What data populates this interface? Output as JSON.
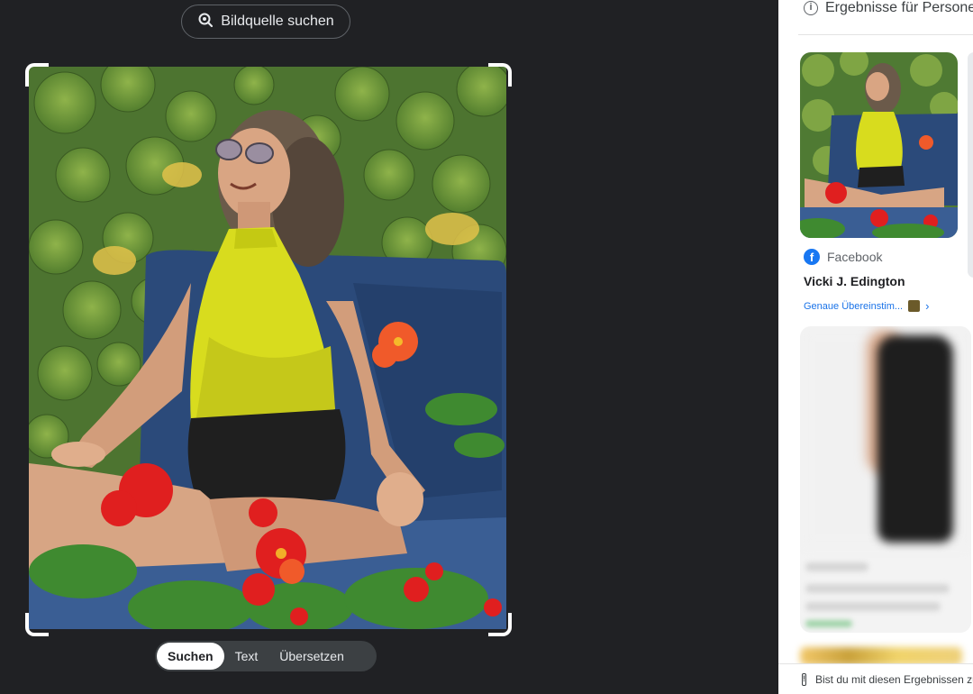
{
  "toolbar": {
    "source_search_label": "Bildquelle suchen"
  },
  "modes": {
    "tabs": [
      {
        "label": "Suchen",
        "active": true
      },
      {
        "label": "Text",
        "active": false
      },
      {
        "label": "Übersetzen",
        "active": false
      }
    ]
  },
  "results": {
    "header": "Ergebnisse für Personen",
    "first": {
      "source": "Facebook",
      "title": "Vicki J. Edington",
      "match_label": "Genaue Übereinstim..."
    },
    "feedback_text": "Bist du mit diesen Ergebnissen zufrieden?"
  },
  "icons": {
    "source_search": "lens-search-icon",
    "info": "info-icon",
    "facebook": "facebook-icon",
    "chevron": "chevron-right-icon",
    "feedback": "feedback-icon"
  },
  "colors": {
    "background": "#202124",
    "accent_link": "#1a73e8",
    "facebook": "#1877f2",
    "top_yellow": "#d8dc1e",
    "cushion_blue": "#2b4a7a",
    "flower_red": "#e01f1f"
  }
}
